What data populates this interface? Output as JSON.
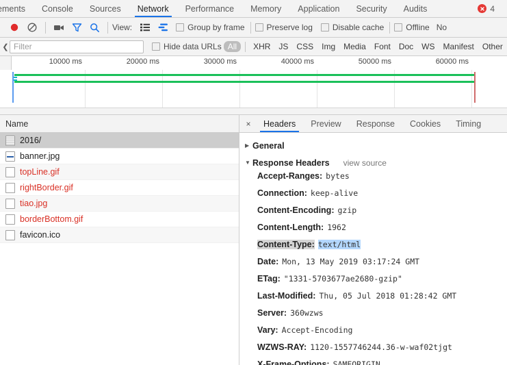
{
  "devtools_tabs": {
    "items": [
      {
        "label": "ements",
        "active": false
      },
      {
        "label": "Console",
        "active": false
      },
      {
        "label": "Sources",
        "active": false
      },
      {
        "label": "Network",
        "active": true
      },
      {
        "label": "Performance",
        "active": false
      },
      {
        "label": "Memory",
        "active": false
      },
      {
        "label": "Application",
        "active": false
      },
      {
        "label": "Security",
        "active": false
      },
      {
        "label": "Audits",
        "active": false
      }
    ],
    "error_icon": "×",
    "error_count": "4"
  },
  "toolbar": {
    "record_icon": "record-icon",
    "clear_icon": "clear-icon",
    "camera_icon": "camera-icon",
    "filter_icon": "filter-funnel-icon",
    "search_icon": "search-icon",
    "view_label": "View:",
    "list_view_icon": "list-view-icon",
    "waterfall_view_icon": "waterfall-view-icon",
    "group_by_frame": "Group by frame",
    "preserve_log": "Preserve log",
    "disable_cache": "Disable cache",
    "offline": "Offline",
    "throttling_partial": "No"
  },
  "filterbar": {
    "chevron": "❮",
    "placeholder": "Filter",
    "value": "",
    "hide_data_urls": "Hide data URLs",
    "types": [
      {
        "label": "All",
        "selected": true
      },
      {
        "label": "XHR",
        "selected": false
      },
      {
        "label": "JS",
        "selected": false
      },
      {
        "label": "CSS",
        "selected": false
      },
      {
        "label": "Img",
        "selected": false
      },
      {
        "label": "Media",
        "selected": false
      },
      {
        "label": "Font",
        "selected": false
      },
      {
        "label": "Doc",
        "selected": false
      },
      {
        "label": "WS",
        "selected": false
      },
      {
        "label": "Manifest",
        "selected": false
      },
      {
        "label": "Other",
        "selected": false
      }
    ]
  },
  "overview": {
    "ticks": [
      "10000 ms",
      "20000 ms",
      "30000 ms",
      "40000 ms",
      "50000 ms",
      "60000 ms"
    ],
    "band_color": "#1bc05a",
    "dom_content_loaded_color": "#5a9bf0",
    "load_event_color": "#d06b6b"
  },
  "requests": {
    "column_header": "Name",
    "rows": [
      {
        "name": "2016/",
        "icon": "document-icon",
        "error": false,
        "selected": true
      },
      {
        "name": "banner.jpg",
        "icon": "image-icon",
        "error": false,
        "selected": false
      },
      {
        "name": "topLine.gif",
        "icon": "file-icon",
        "error": true,
        "selected": false
      },
      {
        "name": "rightBorder.gif",
        "icon": "file-icon",
        "error": true,
        "selected": false
      },
      {
        "name": "tiao.jpg",
        "icon": "file-icon",
        "error": true,
        "selected": false
      },
      {
        "name": "borderBottom.gif",
        "icon": "file-icon",
        "error": true,
        "selected": false
      },
      {
        "name": "favicon.ico",
        "icon": "file-icon",
        "error": false,
        "selected": false
      }
    ]
  },
  "details": {
    "close_icon": "×",
    "tabs": [
      {
        "label": "Headers",
        "active": true
      },
      {
        "label": "Preview",
        "active": false
      },
      {
        "label": "Response",
        "active": false
      },
      {
        "label": "Cookies",
        "active": false
      },
      {
        "label": "Timing",
        "active": false
      }
    ],
    "sections": {
      "general": {
        "title": "General",
        "triangle": "▶",
        "expanded": false
      },
      "response_headers": {
        "title": "Response Headers",
        "triangle": "▼",
        "expanded": true,
        "view_source": "view source"
      }
    },
    "response_headers": [
      {
        "name": "Accept-Ranges:",
        "value": "bytes",
        "selected": false
      },
      {
        "name": "Connection:",
        "value": "keep-alive",
        "selected": false
      },
      {
        "name": "Content-Encoding:",
        "value": "gzip",
        "selected": false
      },
      {
        "name": "Content-Length:",
        "value": "1962",
        "selected": false
      },
      {
        "name": "Content-Type:",
        "value": "text/html",
        "selected": true
      },
      {
        "name": "Date:",
        "value": "Mon, 13 May 2019 03:17:24 GMT",
        "selected": false
      },
      {
        "name": "ETag:",
        "value": "\"1331-5703677ae2680-gzip\"",
        "selected": false
      },
      {
        "name": "Last-Modified:",
        "value": "Thu, 05 Jul 2018 01:28:42 GMT",
        "selected": false
      },
      {
        "name": "Server:",
        "value": "360wzws",
        "selected": false
      },
      {
        "name": "Vary:",
        "value": "Accept-Encoding",
        "selected": false
      },
      {
        "name": "WZWS-RAY:",
        "value": "1120-1557746244.36-w-waf02tjgt",
        "selected": false
      },
      {
        "name": "X-Frame-Options:",
        "value": "SAMEORIGIN",
        "selected": false,
        "clipped": true
      }
    ]
  }
}
